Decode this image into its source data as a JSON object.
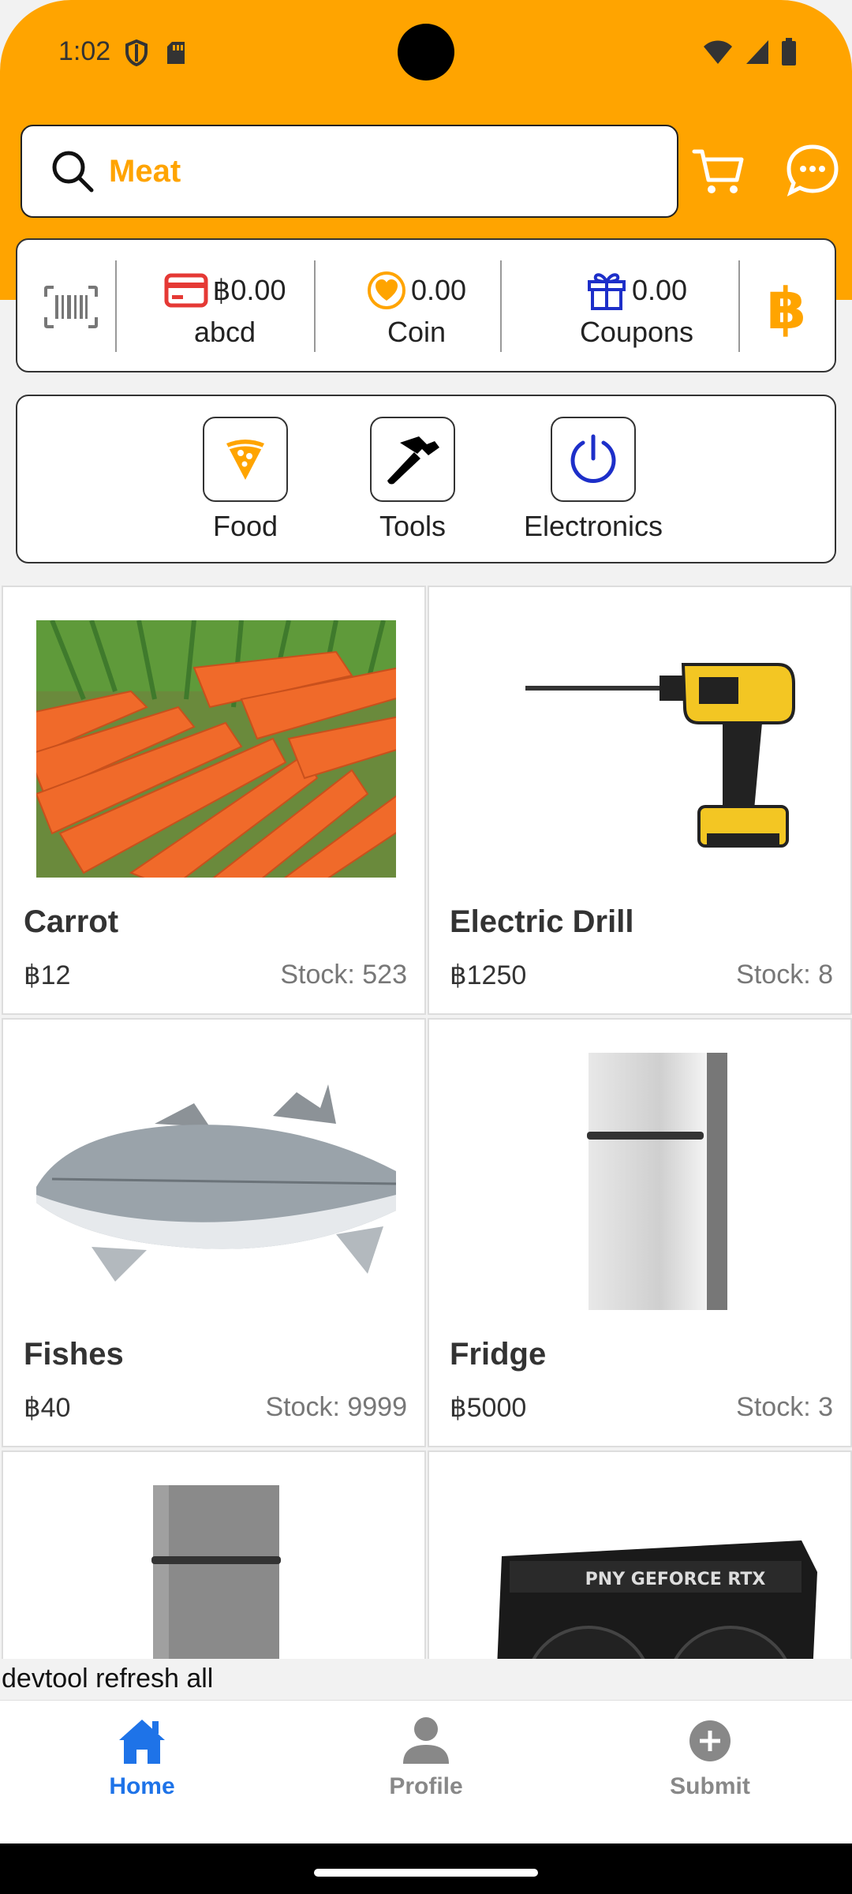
{
  "status_bar": {
    "time": "1:02",
    "left_icons": [
      "shield-icon",
      "sd-card-icon"
    ],
    "right_icons": [
      "wifi-icon",
      "signal-icon",
      "battery-icon"
    ]
  },
  "header": {
    "search_value": "Meat",
    "accent_color": "#FFA400",
    "icons": [
      "search-icon",
      "cart-icon",
      "chat-icon"
    ]
  },
  "wallet": {
    "balance": {
      "value": "฿0.00",
      "label": "abcd",
      "icon": "card-icon"
    },
    "coin": {
      "value": "0.00",
      "label": "Coin",
      "icon": "heart-coin-icon"
    },
    "coupons": {
      "value": "0.00",
      "label": "Coupons",
      "icon": "gift-icon"
    },
    "left_icon": "barcode-icon",
    "right_icon": "bitcoin-icon"
  },
  "categories": [
    {
      "label": "Food",
      "icon": "pizza-icon"
    },
    {
      "label": "Tools",
      "icon": "hammer-icon"
    },
    {
      "label": "Electronics",
      "icon": "power-icon"
    }
  ],
  "products": [
    {
      "name": "Carrot",
      "price": "฿12",
      "stock": "Stock: 523"
    },
    {
      "name": "Electric Drill",
      "price": "฿1250",
      "stock": "Stock: 8"
    },
    {
      "name": "Fishes",
      "price": "฿40",
      "stock": "Stock: 9999"
    },
    {
      "name": "Fridge",
      "price": "฿5000",
      "stock": "Stock: 3"
    },
    {
      "name": "",
      "price": "",
      "stock": ""
    },
    {
      "name": "",
      "price": "",
      "stock": ""
    }
  ],
  "devtool": {
    "label": "devtool refresh all"
  },
  "bottom_nav": {
    "items": [
      {
        "label": "Home",
        "icon": "home-icon",
        "active": true
      },
      {
        "label": "Profile",
        "icon": "person-icon",
        "active": false
      },
      {
        "label": "Submit",
        "icon": "plus-circle-icon",
        "active": false
      }
    ],
    "active_color": "#1E73E8"
  }
}
